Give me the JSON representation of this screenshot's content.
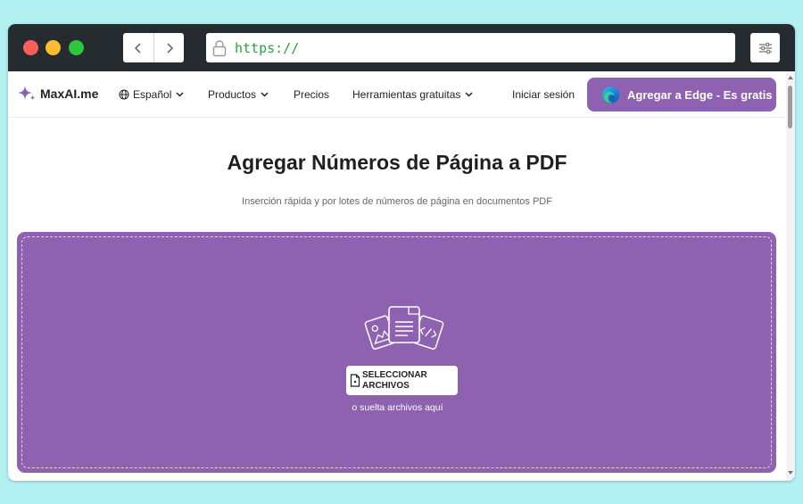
{
  "browser": {
    "url": "https://",
    "colors": {
      "chrome": "#262b30",
      "url_text": "#2e9e3e",
      "close": "#ff5f57",
      "minimize": "#febc2e",
      "maximize": "#2bc840"
    }
  },
  "site": {
    "logo_text": "MaxAI.me",
    "nav": {
      "language": "Español",
      "products": "Productos",
      "pricing": "Precios",
      "free_tools": "Herramientas gratuitas",
      "login": "Iniciar sesión",
      "cta": "Agregar a Edge - Es gratis"
    },
    "colors": {
      "accent": "#8e62b0"
    }
  },
  "hero": {
    "title": "Agregar Números de Página a PDF",
    "subtitle": "Inserción rápida y por lotes de números de página en documentos PDF"
  },
  "dropzone": {
    "button_line1": "SELECCIONAR",
    "button_line2": "ARCHIVOS",
    "hint": "o suelta archivos aquí"
  },
  "icons": [
    "chevron-left-icon",
    "chevron-right-icon",
    "lock-icon",
    "sliders-icon",
    "sparkle-logo-icon",
    "globe-icon",
    "chevron-down-icon",
    "edge-logo-icon",
    "documents-illustration-icon",
    "file-icon"
  ]
}
